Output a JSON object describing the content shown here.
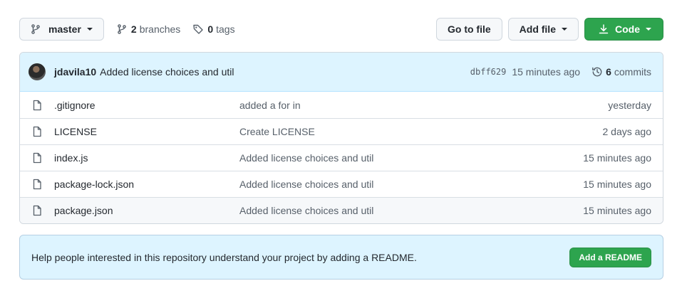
{
  "toolbar": {
    "branch_label": "master",
    "branches_count": "2",
    "branches_label": "branches",
    "tags_count": "0",
    "tags_label": "tags",
    "goto_label": "Go to file",
    "add_file_label": "Add file",
    "code_label": "Code"
  },
  "commit": {
    "author": "jdavila10",
    "message": "Added license choices and util",
    "sha": "dbff629",
    "time": "15 minutes ago",
    "commits_count": "6",
    "commits_label": "commits"
  },
  "files": [
    {
      "name": ".gitignore",
      "message": "added a for in",
      "age": "yesterday"
    },
    {
      "name": "LICENSE",
      "message": "Create LICENSE",
      "age": "2 days ago"
    },
    {
      "name": "index.js",
      "message": "Added license choices and util",
      "age": "15 minutes ago"
    },
    {
      "name": "package-lock.json",
      "message": "Added license choices and util",
      "age": "15 minutes ago"
    },
    {
      "name": "package.json",
      "message": "Added license choices and util",
      "age": "15 minutes ago"
    }
  ],
  "readme": {
    "text": "Help people interested in this repository understand your project by adding a README.",
    "button_label": "Add a README"
  },
  "colors": {
    "accent_green": "#2da44e",
    "banner_blue": "#ddf4ff"
  },
  "icons": {
    "branch": "git-branch-icon",
    "tag": "tag-icon",
    "download": "download-icon",
    "history": "history-icon",
    "file": "file-icon"
  }
}
